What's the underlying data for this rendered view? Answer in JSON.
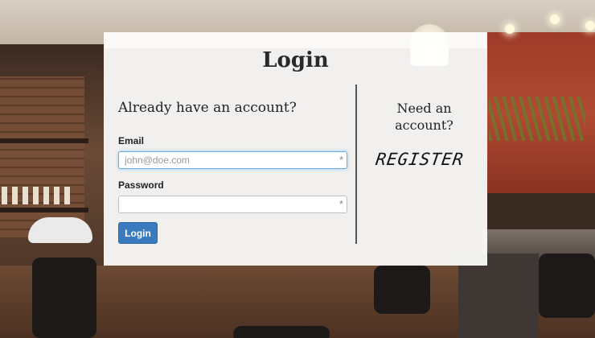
{
  "login": {
    "title": "Login",
    "existing_heading": "Already have an account?",
    "email_label": "Email",
    "email_placeholder": "john@doe.com",
    "email_value": "",
    "password_label": "Password",
    "password_value": "",
    "required_marker": "*",
    "login_button": "Login"
  },
  "register": {
    "heading_line1": "Need an",
    "heading_line2": "account?",
    "link_text": "REGISTER"
  },
  "colors": {
    "button": "#3a7bbf",
    "focus_border": "#66afe9",
    "panel_bg": "#ffffff"
  }
}
